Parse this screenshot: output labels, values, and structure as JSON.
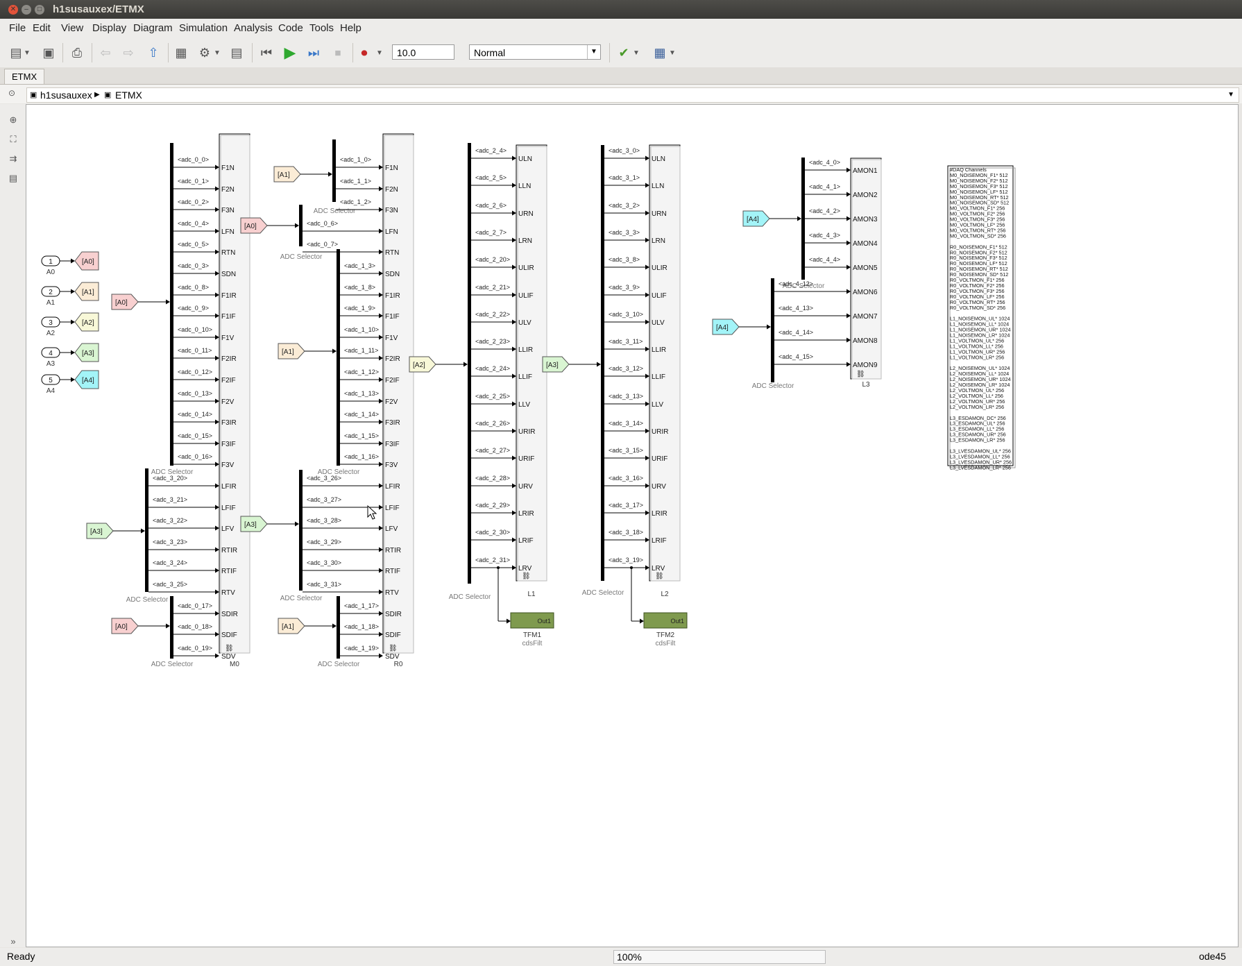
{
  "window": {
    "title": "h1susauxex/ETMX"
  },
  "menu": [
    "File",
    "Edit",
    "View",
    "Display",
    "Diagram",
    "Simulation",
    "Analysis",
    "Code",
    "Tools",
    "Help"
  ],
  "toolbar": {
    "stop_time": "10.0",
    "sim_mode": "Normal"
  },
  "tab": {
    "label": "ETMX"
  },
  "breadcrumb": {
    "root": "h1susauxex",
    "current": "ETMX"
  },
  "status": {
    "text": "Ready",
    "zoom": "100%",
    "solver": "ode45"
  },
  "colors": {
    "A0": "#f8d0d0",
    "A1": "#fbecd6",
    "A2": "#f8f8d8",
    "A3": "#d9f5d2",
    "A4": "#a3f4f8"
  },
  "diagram": {
    "inports": [
      {
        "num": "1",
        "name": "A0",
        "tag": "[A0]"
      },
      {
        "num": "2",
        "name": "A1",
        "tag": "[A1]"
      },
      {
        "num": "3",
        "name": "A2",
        "tag": "[A2]"
      },
      {
        "num": "4",
        "name": "A3",
        "tag": "[A3]"
      },
      {
        "num": "5",
        "name": "A4",
        "tag": "[A4]"
      }
    ],
    "selector_label": "ADC Selector",
    "subsystems": [
      {
        "name": "M0",
        "ports": [
          "F1N",
          "F2N",
          "F3N",
          "LFN",
          "RTN",
          "SDN",
          "F1IR",
          "F1IF",
          "F1V",
          "F2IR",
          "F2IF",
          "F2V",
          "F3IR",
          "F3IF",
          "F3V",
          "LFIR",
          "LFIF",
          "LFV",
          "RTIR",
          "RTIF",
          "RTV",
          "SDIR",
          "SDIF",
          "SDV"
        ],
        "signals": [
          "<adc_0_0>",
          "<adc_0_1>",
          "<adc_0_2>",
          "<adc_0_4>",
          "<adc_0_5>",
          "<adc_0_3>",
          "<adc_0_8>",
          "<adc_0_9>",
          "<adc_0_10>",
          "<adc_0_11>",
          "<adc_0_12>",
          "<adc_0_13>",
          "<adc_0_14>",
          "<adc_0_15>",
          "<adc_0_16>",
          "<adc_3_20>",
          "<adc_3_21>",
          "<adc_3_22>",
          "<adc_3_23>",
          "<adc_3_24>",
          "<adc_3_25>",
          "<adc_0_17>",
          "<adc_0_18>",
          "<adc_0_19>"
        ]
      },
      {
        "name": "R0",
        "ports": [
          "F1N",
          "F2N",
          "F3N",
          "LFN",
          "RTN",
          "SDN",
          "F1IR",
          "F1IF",
          "F1V",
          "F2IR",
          "F2IF",
          "F2V",
          "F3IR",
          "F3IF",
          "F3V",
          "LFIR",
          "LFIF",
          "LFV",
          "RTIR",
          "RTIF",
          "RTV",
          "SDIR",
          "SDIF",
          "SDV"
        ],
        "signals": [
          "<adc_1_0>",
          "<adc_1_1>",
          "<adc_1_2>",
          "<adc_0_6>",
          "<adc_0_7>",
          "<adc_1_3>",
          "<adc_1_8>",
          "<adc_1_9>",
          "<adc_1_10>",
          "<adc_1_11>",
          "<adc_1_12>",
          "<adc_1_13>",
          "<adc_1_14>",
          "<adc_1_15>",
          "<adc_1_16>",
          "<adc_3_26>",
          "<adc_3_27>",
          "<adc_3_28>",
          "<adc_3_29>",
          "<adc_3_30>",
          "<adc_3_31>",
          "<adc_1_17>",
          "<adc_1_18>",
          "<adc_1_19>"
        ]
      },
      {
        "name": "L1",
        "ports": [
          "ULN",
          "LLN",
          "URN",
          "LRN",
          "ULIR",
          "ULIF",
          "ULV",
          "LLIR",
          "LLIF",
          "LLV",
          "URIR",
          "URIF",
          "URV",
          "LRIR",
          "LRIF",
          "LRV"
        ],
        "signals": [
          "<adc_2_4>",
          "<adc_2_5>",
          "<adc_2_6>",
          "<adc_2_7>",
          "<adc_2_20>",
          "<adc_2_21>",
          "<adc_2_22>",
          "<adc_2_23>",
          "<adc_2_24>",
          "<adc_2_25>",
          "<adc_2_26>",
          "<adc_2_27>",
          "<adc_2_28>",
          "<adc_2_29>",
          "<adc_2_30>",
          "<adc_2_31>"
        ]
      },
      {
        "name": "L2",
        "ports": [
          "ULN",
          "LLN",
          "URN",
          "LRN",
          "ULIR",
          "ULIF",
          "ULV",
          "LLIR",
          "LLIF",
          "LLV",
          "URIR",
          "URIF",
          "URV",
          "LRIR",
          "LRIF",
          "LRV"
        ],
        "signals": [
          "<adc_3_0>",
          "<adc_3_1>",
          "<adc_3_2>",
          "<adc_3_3>",
          "<adc_3_8>",
          "<adc_3_9>",
          "<adc_3_10>",
          "<adc_3_11>",
          "<adc_3_12>",
          "<adc_3_13>",
          "<adc_3_14>",
          "<adc_3_15>",
          "<adc_3_16>",
          "<adc_3_17>",
          "<adc_3_18>",
          "<adc_3_19>"
        ]
      },
      {
        "name": "L3",
        "ports": [
          "AMON1",
          "AMON2",
          "AMON3",
          "AMON4",
          "AMON5",
          "AMON6",
          "AMON7",
          "AMON8",
          "AMON9"
        ],
        "signals": [
          "<adc_4_0>",
          "<adc_4_1>",
          "<adc_4_2>",
          "<adc_4_3>",
          "<adc_4_4>",
          "<adc_4_12>",
          "<adc_4_13>",
          "<adc_4_14>",
          "<adc_4_15>"
        ]
      }
    ],
    "filters": [
      {
        "name": "TFM1",
        "sub": "cdsFilt",
        "port": "Out1"
      },
      {
        "name": "TFM2",
        "sub": "cdsFilt",
        "port": "Out1"
      }
    ],
    "daq_lines": [
      "#DAQ Channels",
      "M0_NOISEMON_F1* 512",
      "M0_NOISEMON_F2* 512",
      "M0_NOISEMON_F3* 512",
      "M0_NOISEMON_LF* 512",
      "M0_NOISEMON_RT* 512",
      "M0_NOISEMON_SD* 512",
      "M0_VOLTMON_F1* 256",
      "M0_VOLTMON_F2* 256",
      "M0_VOLTMON_F3* 256",
      "M0_VOLTMON_LF* 256",
      "M0_VOLTMON_RT* 256",
      "M0_VOLTMON_SD* 256",
      "",
      "R0_NOISEMON_F1* 512",
      "R0_NOISEMON_F2* 512",
      "R0_NOISEMON_F3* 512",
      "R0_NOISEMON_LF* 512",
      "R0_NOISEMON_RT* 512",
      "R0_NOISEMON_SD* 512",
      "R0_VOLTMON_F1* 256",
      "R0_VOLTMON_F2* 256",
      "R0_VOLTMON_F3* 256",
      "R0_VOLTMON_LF* 256",
      "R0_VOLTMON_RT* 256",
      "R0_VOLTMON_SD* 256",
      "",
      "L1_NOISEMON_UL* 1024",
      "L1_NOISEMON_LL* 1024",
      "L1_NOISEMON_UR* 1024",
      "L1_NOISEMON_LR* 1024",
      "L1_VOLTMON_UL* 256",
      "L1_VOLTMON_LL* 256",
      "L1_VOLTMON_UR* 256",
      "L1_VOLTMON_LR* 256",
      "",
      "L2_NOISEMON_UL* 1024",
      "L2_NOISEMON_LL* 1024",
      "L2_NOISEMON_UR* 1024",
      "L2_NOISEMON_LR* 1024",
      "L2_VOLTMON_UL* 256",
      "L2_VOLTMON_LL* 256",
      "L2_VOLTMON_UR* 256",
      "L2_VOLTMON_LR* 256",
      "",
      "L3_ESDAMON_DC* 256",
      "L3_ESDAMON_UL* 256",
      "L3_ESDAMON_LL* 256",
      "L3_ESDAMON_UR* 256",
      "L3_ESDAMON_LR* 256",
      "",
      "L3_LVESDAMON_UL* 256",
      "L3_LVESDAMON_LL* 256",
      "L3_LVESDAMON_UR* 256",
      "L3_LVESDAMON_LR* 256"
    ]
  }
}
